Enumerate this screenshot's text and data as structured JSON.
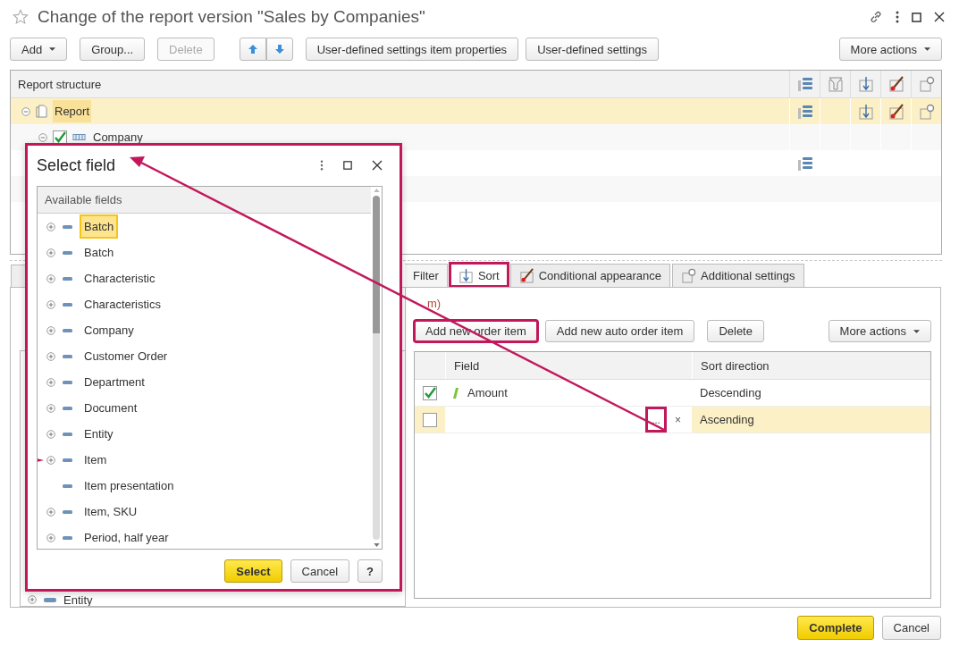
{
  "window": {
    "title": "Change of the report version \"Sales by Companies\"",
    "favorite": false
  },
  "toolbar": {
    "buttons": [
      {
        "kind": "dropdown",
        "label": "Add",
        "disabled": false
      },
      {
        "kind": "plain",
        "label": "Group...",
        "disabled": false
      },
      {
        "kind": "plain",
        "label": "Delete",
        "disabled": true
      },
      {
        "kind": "move_up",
        "disabled": false
      },
      {
        "kind": "move_down",
        "disabled": false
      },
      {
        "kind": "plain",
        "label": "User-defined settings item properties",
        "disabled": false
      },
      {
        "kind": "plain",
        "label": "User-defined settings",
        "disabled": false
      }
    ],
    "more": "More actions"
  },
  "structure": {
    "header": "Report structure",
    "rows": [
      {
        "label": "Report",
        "kind": "report",
        "selected": true,
        "expanded": true,
        "has_grouping": true,
        "has_filter": false,
        "has_sort": true,
        "has_appearance": true,
        "has_settings": true,
        "children": [
          {
            "label": "Company",
            "kind": "grouping",
            "checked": true,
            "selected": false,
            "expanded": true,
            "has_grouping": false,
            "has_filter": false,
            "has_sort": false,
            "has_appearance": false,
            "has_settings": false,
            "children": [
              {
                "selected": false,
                "has_grouping": true,
                "has_filter": false,
                "has_sort": false,
                "has_appearance": false,
                "has_settings": false
              }
            ]
          }
        ]
      }
    ]
  },
  "left_panel": {
    "rows": [
      {
        "label": "Entity",
        "expandable": true
      }
    ]
  },
  "tabs": [
    {
      "label": "Filter",
      "kind": "filter",
      "selected": false,
      "callout": false
    },
    {
      "label": "Sort",
      "kind": "sort",
      "selected": true,
      "callout": true
    },
    {
      "label": "Conditional appearance",
      "kind": "appearance",
      "selected": false,
      "callout": false
    },
    {
      "label": "Additional settings",
      "kind": "settings",
      "selected": false,
      "callout": false
    }
  ],
  "sort_pane": {
    "caption": "m)",
    "buttons": [
      {
        "label": "Add new order item",
        "callout": true
      },
      {
        "label": "Add new auto order item",
        "callout": false
      },
      {
        "label": "Delete",
        "callout": false
      }
    ],
    "more": "More actions",
    "columns": [
      "Field",
      "Sort direction"
    ],
    "rows": [
      {
        "checked": true,
        "field": "Amount",
        "direction": "Descending",
        "selected": false,
        "editing": false
      },
      {
        "checked": false,
        "direction": "Ascending",
        "selected": true,
        "editing": true,
        "choose_button": "...",
        "clear_button": "×",
        "choose_callout": true
      }
    ]
  },
  "dialog": {
    "title": "Select field",
    "header": "Available fields",
    "items": [
      {
        "label": "Batch",
        "expandable": true,
        "selected": true,
        "pointer": false
      },
      {
        "label": "Batch",
        "expandable": true,
        "selected": false,
        "pointer": false
      },
      {
        "label": "Characteristic",
        "expandable": true,
        "selected": false,
        "pointer": false
      },
      {
        "label": "Characteristics",
        "expandable": true,
        "selected": false,
        "pointer": false
      },
      {
        "label": "Company",
        "expandable": true,
        "selected": false,
        "pointer": false
      },
      {
        "label": "Customer Order",
        "expandable": true,
        "selected": false,
        "pointer": false
      },
      {
        "label": "Department",
        "expandable": true,
        "selected": false,
        "pointer": false
      },
      {
        "label": "Document",
        "expandable": true,
        "selected": false,
        "pointer": false
      },
      {
        "label": "Entity",
        "expandable": true,
        "selected": false,
        "pointer": false
      },
      {
        "label": "Item",
        "expandable": true,
        "selected": false,
        "pointer": true
      },
      {
        "label": "Item presentation",
        "expandable": false,
        "selected": false,
        "pointer": false
      },
      {
        "label": "Item, SKU",
        "expandable": true,
        "selected": false,
        "pointer": false
      },
      {
        "label": "Period, half year",
        "expandable": true,
        "selected": false,
        "pointer": false
      }
    ],
    "buttons": [
      {
        "label": "Select",
        "kind": "default"
      },
      {
        "label": "Cancel",
        "kind": "plain"
      },
      {
        "label": "?",
        "kind": "help"
      }
    ]
  },
  "footer": {
    "buttons": [
      {
        "label": "Complete",
        "kind": "default"
      },
      {
        "label": "Cancel",
        "kind": "plain"
      }
    ]
  }
}
